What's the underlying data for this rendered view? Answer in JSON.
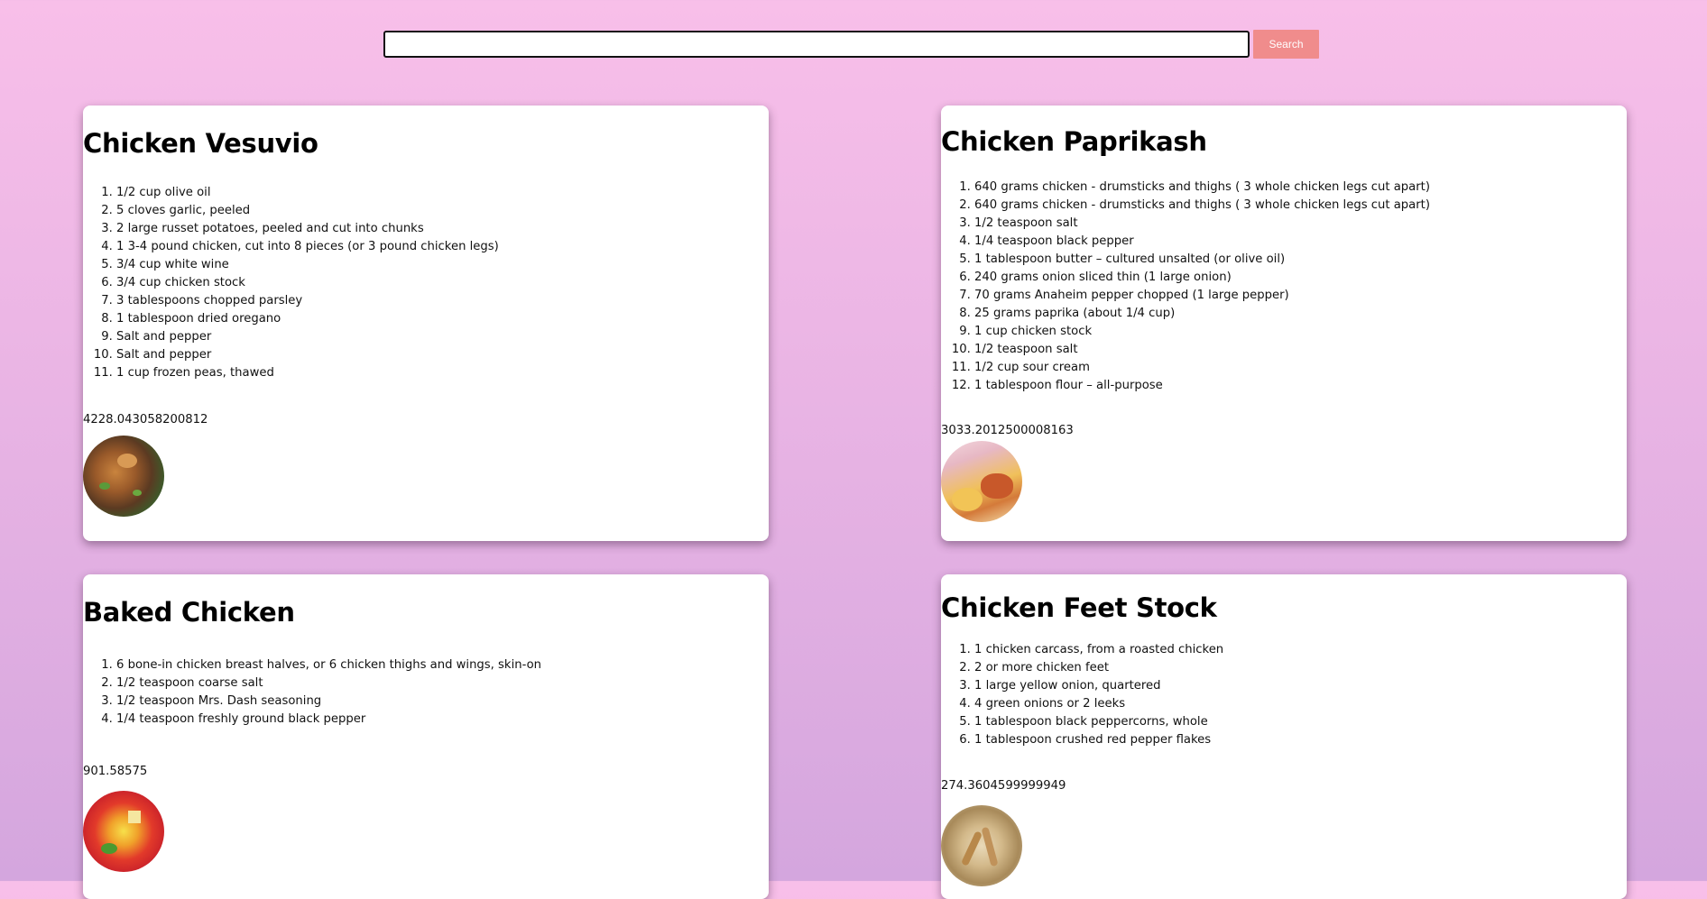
{
  "search": {
    "placeholder": "",
    "value": "",
    "button_label": "Search"
  },
  "recipes": [
    {
      "title": "Chicken Vesuvio",
      "ingredients": [
        "1/2 cup olive oil",
        "5 cloves garlic, peeled",
        "2 large russet potatoes, peeled and cut into chunks",
        "1 3-4 pound chicken, cut into 8 pieces (or 3 pound chicken legs)",
        "3/4 cup white wine",
        "3/4 cup chicken stock",
        "3 tablespoons chopped parsley",
        "1 tablespoon dried oregano",
        "Salt and pepper",
        "Salt and pepper",
        "1 cup frozen peas, thawed"
      ],
      "calories": "4228.043058200812"
    },
    {
      "title": "Chicken Paprikash",
      "ingredients": [
        "640 grams chicken - drumsticks and thighs ( 3 whole chicken legs cut apart)",
        "640 grams chicken - drumsticks and thighs ( 3 whole chicken legs cut apart)",
        "1/2 teaspoon salt",
        "1/4 teaspoon black pepper",
        "1 tablespoon butter – cultured unsalted (or olive oil)",
        "240 grams onion sliced thin (1 large onion)",
        "70 grams Anaheim pepper chopped (1 large pepper)",
        "25 grams paprika (about 1/4 cup)",
        "1 cup chicken stock",
        "1/2 teaspoon salt",
        "1/2 cup sour cream",
        "1 tablespoon flour – all-purpose"
      ],
      "calories": "3033.2012500008163"
    },
    {
      "title": "Baked Chicken",
      "ingredients": [
        "6 bone-in chicken breast halves, or 6 chicken thighs and wings, skin-on",
        "1/2 teaspoon coarse salt",
        "1/2 teaspoon Mrs. Dash seasoning",
        "1/4 teaspoon freshly ground black pepper"
      ],
      "calories": "901.58575"
    },
    {
      "title": "Chicken Feet Stock",
      "ingredients": [
        "1 chicken carcass, from a roasted chicken",
        "2 or more chicken feet",
        "1 large yellow onion, quartered",
        "4 green onions or 2 leeks",
        "1 tablespoon black peppercorns, whole",
        "1 tablespoon crushed red pepper flakes"
      ],
      "calories": "274.3604599999949"
    }
  ]
}
